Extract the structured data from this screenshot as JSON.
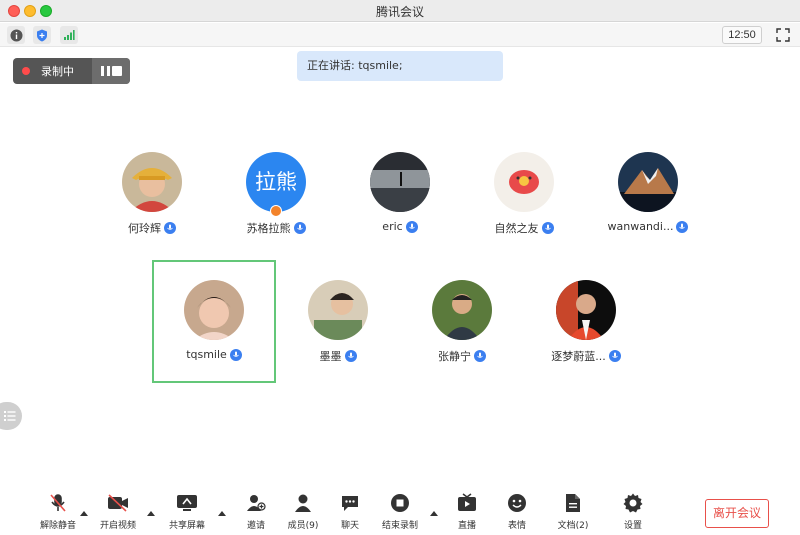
{
  "window": {
    "title": "腾讯会议"
  },
  "status_bar": {
    "time": "12:50"
  },
  "recording": {
    "label": "录制中"
  },
  "speaking_banner": {
    "text": "正在讲话: tqsmile;"
  },
  "participants_row1": [
    {
      "name": "何玲辉"
    },
    {
      "name": "苏格拉熊",
      "avatar_text": "拉熊"
    },
    {
      "name": "eric"
    },
    {
      "name": "自然之友"
    },
    {
      "name": "wanwandi..."
    }
  ],
  "participants_row2": [
    {
      "name": "tqsmile"
    },
    {
      "name": "墨墨"
    },
    {
      "name": "张静宁"
    },
    {
      "name": "逐梦蔚蓝..."
    }
  ],
  "toolbar": {
    "unmute": "解除静音",
    "start_video": "开启视频",
    "share_screen": "共享屏幕",
    "invite": "邀请",
    "members": "成员(9)",
    "chat": "聊天",
    "end_recording": "结束录制",
    "live": "直播",
    "reactions": "表情",
    "docs": "文档(2)",
    "settings": "设置",
    "leave": "离开会议"
  },
  "colors": {
    "accent": "#3b7ff0",
    "leave": "#e8504a",
    "speaker_frame": "#63c778",
    "banner": "#d9e8fb"
  }
}
